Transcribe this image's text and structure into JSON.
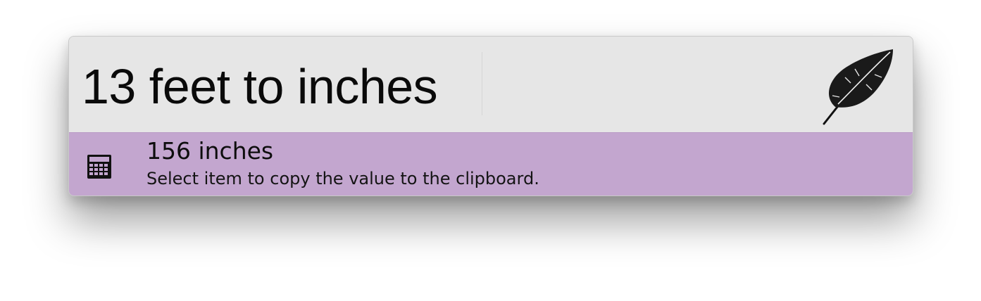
{
  "search": {
    "query": "13 feet to inches"
  },
  "header": {
    "logo_icon": "feather-icon"
  },
  "results": [
    {
      "icon": "calculator-icon",
      "title": "156 inches",
      "subtitle": "Select item to copy the value to the clipboard."
    }
  ],
  "colors": {
    "search_background": "#e6e6e6",
    "selected_result_background": "#c3a6cf",
    "text": "#0a0a0a"
  }
}
